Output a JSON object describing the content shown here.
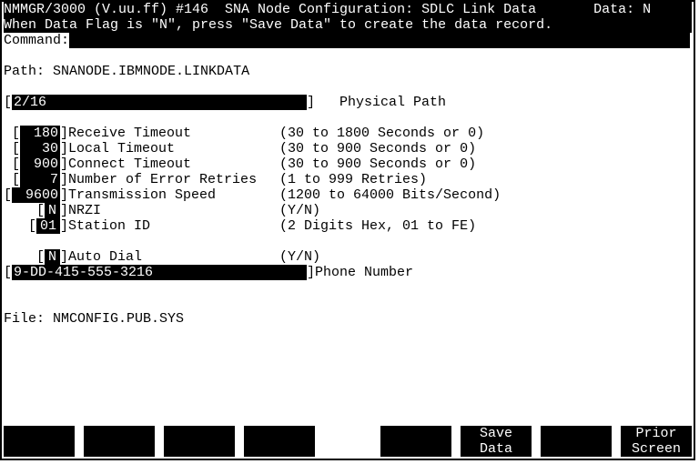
{
  "header": {
    "title_line": "NMMGR/3000 (V.uu.ff) #146  SNA Node Configuration: SDLC Link Data       Data: N",
    "hint_line": "When Data Flag is \"N\", press \"Save Data\" to create the data record.         ",
    "command_label": "Command:",
    "command_value": ""
  },
  "path": {
    "label": "Path:",
    "value": "SNANODE.IBMNODE.LINKDATA"
  },
  "physical_path": {
    "value": "2/16                                ",
    "label": "Physical Path"
  },
  "fields": {
    "receive_timeout": {
      "value": " 180",
      "label": "Receive Timeout",
      "hint": "(30 to 1800 Seconds or 0)"
    },
    "local_timeout": {
      "value": "  30",
      "label": "Local Timeout",
      "hint": "(30 to 900 Seconds or 0)"
    },
    "connect_timeout": {
      "value": " 900",
      "label": "Connect Timeout",
      "hint": "(30 to 900 Seconds or 0)"
    },
    "error_retries": {
      "value": "   7",
      "label": "Number of Error Retries",
      "hint": "(1 to 999 Retries)"
    },
    "transmission": {
      "value": " 9600",
      "label": "Transmission Speed",
      "hint": "(1200 to 64000 Bits/Second)"
    },
    "nrzi": {
      "value": "N",
      "label": "NRZI",
      "hint": "(Y/N)"
    },
    "station_id": {
      "value": "01",
      "label": "Station ID",
      "hint": "(2 Digits Hex, 01 to FE)"
    },
    "auto_dial": {
      "value": "N",
      "label": "Auto Dial",
      "hint": "(Y/N)"
    },
    "phone_number": {
      "value": "9-DD-415-555-3216                   ",
      "label": "Phone Number"
    }
  },
  "file": {
    "label": "File:",
    "value": "NMCONFIG.PUB.SYS"
  },
  "fkeys": {
    "f1": "",
    "f2": "",
    "f3": "",
    "f4": "",
    "f5": "",
    "f6a": "Save",
    "f6b": "Data",
    "f7": "",
    "f8a": "Prior",
    "f8b": "Screen"
  }
}
